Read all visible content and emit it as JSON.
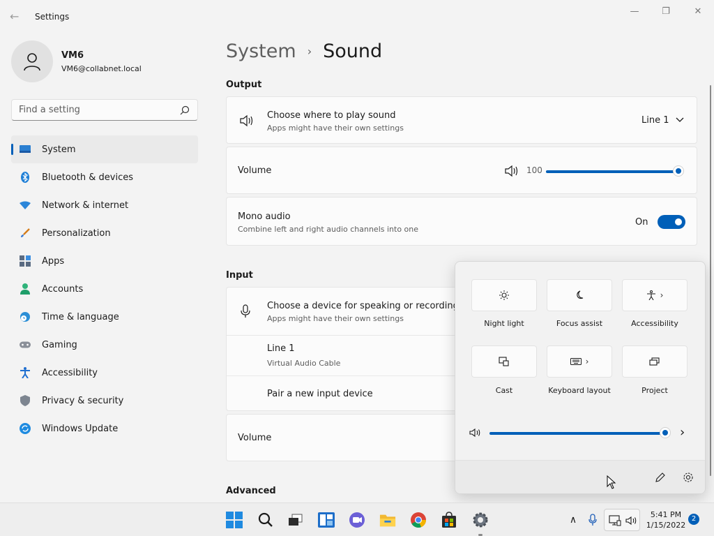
{
  "window": {
    "title": "Settings",
    "back_glyph": "←",
    "min_glyph": "—",
    "max_glyph": "❐",
    "close_glyph": "✕"
  },
  "user": {
    "name": "VM6",
    "email": "VM6@collabnet.local"
  },
  "search": {
    "placeholder": "Find a setting"
  },
  "sidebar": {
    "items": [
      {
        "label": "System",
        "icon": "system-icon",
        "active": true
      },
      {
        "label": "Bluetooth & devices",
        "icon": "bluetooth-icon"
      },
      {
        "label": "Network & internet",
        "icon": "network-icon"
      },
      {
        "label": "Personalization",
        "icon": "brush-icon"
      },
      {
        "label": "Apps",
        "icon": "apps-icon"
      },
      {
        "label": "Accounts",
        "icon": "person-icon"
      },
      {
        "label": "Time & language",
        "icon": "globe-clock-icon"
      },
      {
        "label": "Gaming",
        "icon": "controller-icon"
      },
      {
        "label": "Accessibility",
        "icon": "accessibility-icon"
      },
      {
        "label": "Privacy & security",
        "icon": "shield-icon"
      },
      {
        "label": "Windows Update",
        "icon": "update-icon"
      }
    ]
  },
  "breadcrumb": {
    "parent": "System",
    "separator": "›",
    "current": "Sound"
  },
  "output": {
    "heading": "Output",
    "device": {
      "title": "Choose where to play sound",
      "subtitle": "Apps might have their own settings",
      "selected": "Line 1"
    },
    "volume": {
      "label": "Volume",
      "value_text": "100",
      "level": 1.0
    },
    "mono": {
      "title": "Mono audio",
      "subtitle": "Combine left and right audio channels into one",
      "state_text": "On",
      "on": true
    }
  },
  "input": {
    "heading": "Input",
    "device": {
      "title": "Choose a device for speaking or recording",
      "subtitle": "Apps might have their own settings"
    },
    "line1": {
      "title": "Line 1",
      "subtitle": "Virtual Audio Cable"
    },
    "pair": {
      "title": "Pair a new input device"
    },
    "volume": {
      "label": "Volume"
    }
  },
  "advanced": {
    "heading": "Advanced"
  },
  "quick_settings": {
    "tiles": [
      {
        "label": "Night light",
        "icon": "brightness-icon"
      },
      {
        "label": "Focus assist",
        "icon": "moon-icon"
      },
      {
        "label": "Accessibility",
        "icon": "accessibility-icon"
      },
      {
        "label": "Cast",
        "icon": "cast-icon"
      },
      {
        "label": "Keyboard layout",
        "icon": "keyboard-icon"
      },
      {
        "label": "Project",
        "icon": "project-icon"
      }
    ],
    "volume_level": 1.0,
    "chevron_glyph": "›"
  },
  "taskbar": {
    "time": "5:41 PM",
    "date": "1/15/2022",
    "notification_count": "2",
    "tray_chevron_glyph": "∧"
  },
  "colors": {
    "accent": "#005fb8",
    "background": "#f3f3f3",
    "card": "#fbfbfb"
  }
}
